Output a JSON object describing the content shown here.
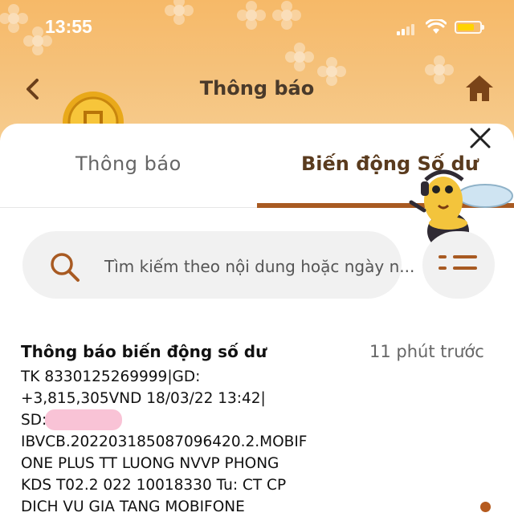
{
  "status_bar": {
    "time": "13:55"
  },
  "header": {
    "title": "Thông báo"
  },
  "tabs": [
    {
      "label": "Thông báo",
      "active": false
    },
    {
      "label": "Biến động Số dư",
      "active": true
    }
  ],
  "search": {
    "placeholder": "Tìm kiếm theo nội dung hoặc ngày n..."
  },
  "notification": {
    "title": "Thông báo biến động số dư",
    "time": "11 phút trước",
    "body": "TK 8330125269999|GD:\n+3,815,305VND 18/03/22 13:42|\nSD:              VND|ND:\nIBVCB.202203185087096420.2.MOBIF\nONE PLUS TT LUONG NVVP PHONG\nKDS T02.2 022 10018330 Tu: CT CP\nDICH VU GIA TANG MOBIFONE"
  },
  "colors": {
    "accent": "#a85a22",
    "header_bg": "#f6b968",
    "redaction": "#f9c3d6",
    "unread_dot": "#b55a1e"
  },
  "icons": [
    "back-icon",
    "home-icon",
    "close-icon",
    "search-icon",
    "filter-icon",
    "coin-icon",
    "bee-mascot-icon"
  ]
}
